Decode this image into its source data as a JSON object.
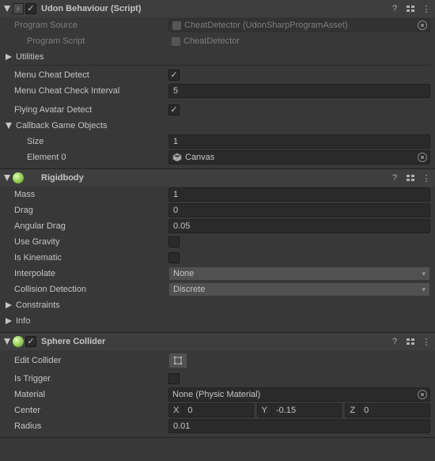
{
  "udon": {
    "title": "Udon Behaviour (Script)",
    "program_source_label": "Program Source",
    "program_source_value": "CheatDetector (UdonSharpProgramAsset)",
    "program_script_label": "Program Script",
    "program_script_value": "CheatDetector",
    "utilities_label": "Utilities",
    "menu_cheat_detect_label": "Menu Cheat Detect",
    "menu_cheat_check_interval_label": "Menu Cheat Check Interval",
    "menu_cheat_check_interval_value": "5",
    "flying_avatar_detect_label": "Flying Avatar Detect",
    "callback_label": "Callback Game Objects",
    "size_label": "Size",
    "size_value": "1",
    "element0_label": "Element 0",
    "element0_value": "Canvas"
  },
  "rigidbody": {
    "title": "Rigidbody",
    "mass_label": "Mass",
    "mass_value": "1",
    "drag_label": "Drag",
    "drag_value": "0",
    "angular_drag_label": "Angular Drag",
    "angular_drag_value": "0.05",
    "use_gravity_label": "Use Gravity",
    "is_kinematic_label": "Is Kinematic",
    "interpolate_label": "Interpolate",
    "interpolate_value": "None",
    "collision_detection_label": "Collision Detection",
    "collision_detection_value": "Discrete",
    "constraints_label": "Constraints",
    "info_label": "Info"
  },
  "sphere": {
    "title": "Sphere Collider",
    "edit_collider_label": "Edit Collider",
    "is_trigger_label": "Is Trigger",
    "material_label": "Material",
    "material_value": "None (Physic Material)",
    "center_label": "Center",
    "center_x_label": "X",
    "center_x_value": "0",
    "center_y_label": "Y",
    "center_y_value": "-0.15",
    "center_z_label": "Z",
    "center_z_value": "0",
    "radius_label": "Radius",
    "radius_value": "0.01"
  }
}
